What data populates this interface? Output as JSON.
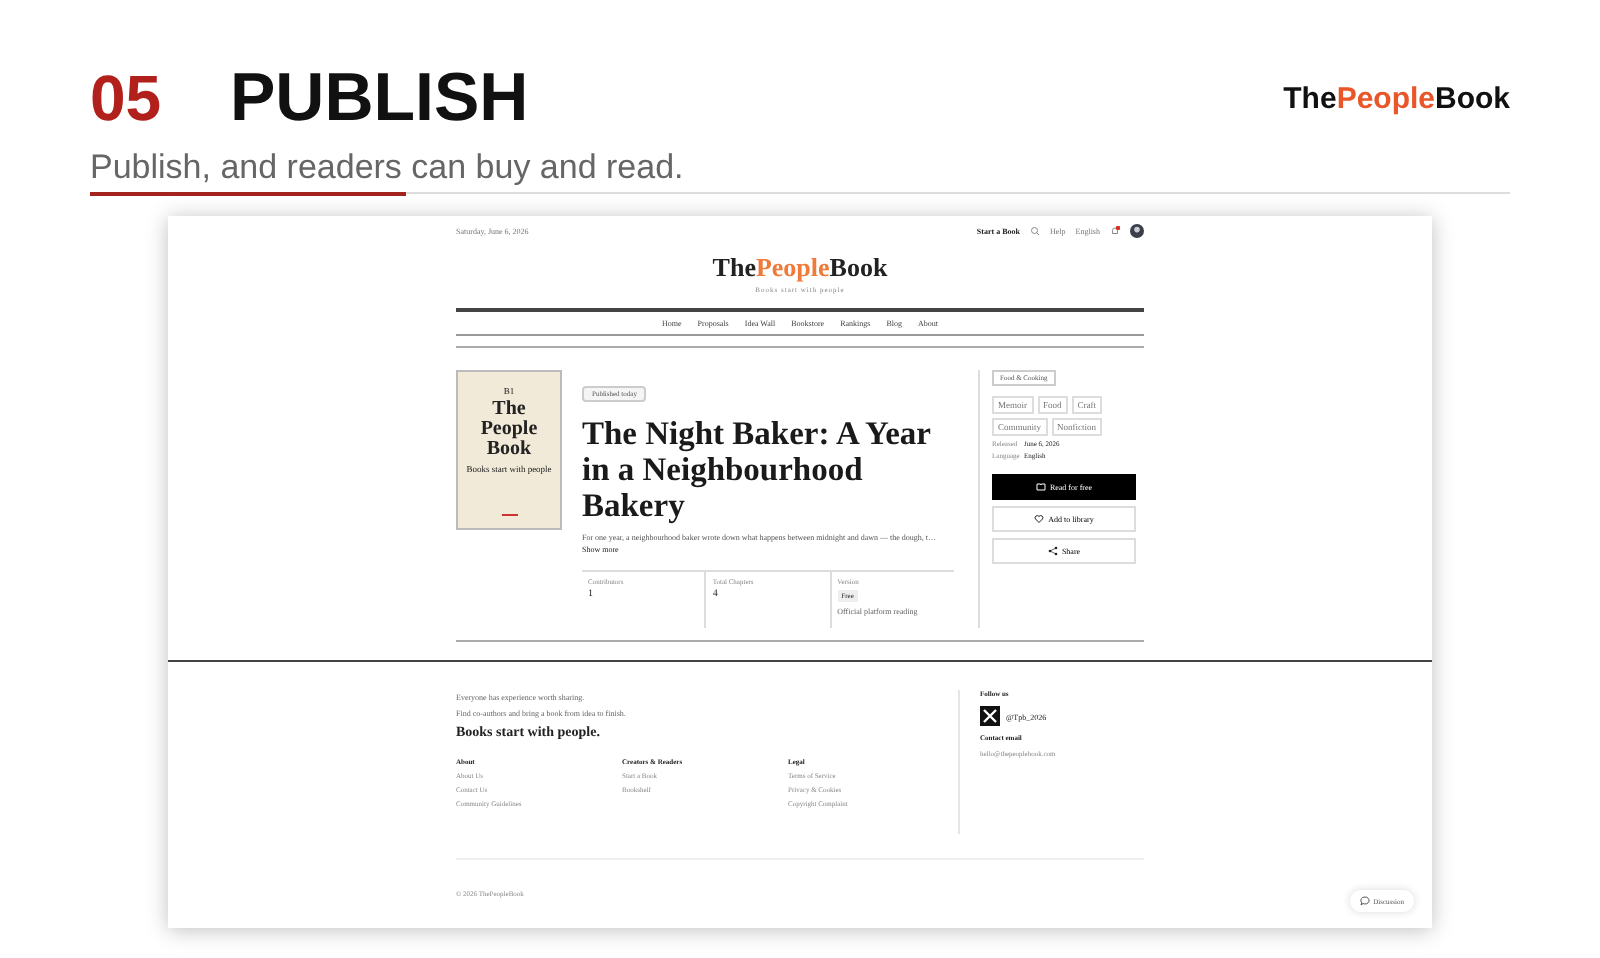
{
  "slide": {
    "number": "05",
    "title": "PUBLISH",
    "subtitle": "Publish, and readers can buy and read.",
    "brand": [
      {
        "text": "The",
        "accent": false
      },
      {
        "text": "People",
        "accent": true
      },
      {
        "text": "Book",
        "accent": false
      }
    ]
  },
  "topbar": {
    "date": "Saturday, June 6, 2026",
    "start": "Start a Book",
    "help": "Help",
    "language": "English",
    "notifications": true
  },
  "site_logo": {
    "parts": [
      {
        "text": "The",
        "accent": false
      },
      {
        "text": "People",
        "accent": true
      },
      {
        "text": "Book",
        "accent": false
      }
    ],
    "tagline": "Books start with people"
  },
  "nav": [
    "Home",
    "Proposals",
    "Idea Wall",
    "Bookstore",
    "Rankings",
    "Blog",
    "About"
  ],
  "book": {
    "cover": {
      "mark": "B1",
      "title": "The People Book",
      "tagline": "Books start with people"
    },
    "status": "Published today",
    "title": "The Night Baker: A Year in a Neighbourhood Bakery",
    "description": "For one year, a neighbourhood baker wrote down what happens between midnight and dawn — the dough, t…",
    "more": "Show more",
    "stats": [
      {
        "label": "Contributors",
        "value": "1",
        "kind": "text"
      },
      {
        "label": "Total Chapters",
        "value": "4",
        "kind": "text"
      },
      {
        "label": "Version",
        "value": "Free",
        "note": "Official platform reading",
        "kind": "badge"
      }
    ],
    "category": "Food & Cooking",
    "tags": [
      "Memoir",
      "Food",
      "Craft",
      "Community",
      "Nonfiction"
    ],
    "meta": [
      {
        "label": "Released",
        "value": "June 6, 2026"
      },
      {
        "label": "Language",
        "value": "English"
      }
    ],
    "actions": [
      {
        "label": "Read for free",
        "kind": "primary"
      },
      {
        "label": "Add to library",
        "kind": "library"
      },
      {
        "label": "Share",
        "kind": "share"
      }
    ]
  },
  "footer": {
    "lines": [
      "Everyone has experience worth sharing.",
      "Find co-authors and bring a book from idea to finish."
    ],
    "slogan": "Books start with people.",
    "columns": [
      {
        "title": "About",
        "links": [
          "About Us",
          "Contact Us",
          "Community Guidelines"
        ]
      },
      {
        "title": "Creators & Readers",
        "links": [
          "Start a Book",
          "Bookshelf"
        ]
      },
      {
        "title": "Legal",
        "links": [
          "Terms of Service",
          "Privacy & Cookies",
          "Copyright Complaint"
        ]
      }
    ],
    "follow": "Follow us",
    "handle": "@Tpb_2026",
    "contact_title": "Contact email",
    "email": "hello@thepeoplebook.com",
    "copyright": "© 2026 ThePeopleBook"
  },
  "discussion": "Discussion"
}
